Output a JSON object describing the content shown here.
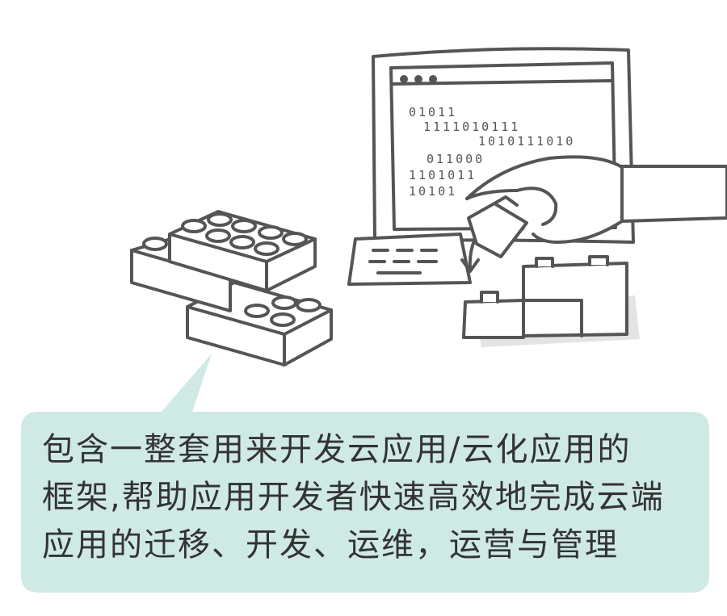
{
  "caption": {
    "lines": [
      "包含一整套用来开发云应用/云化应用的",
      "框架,帮助应用开发者快速高效地完成云端",
      "应用的迁移、开发、运维，运营与管理"
    ]
  },
  "screen": {
    "binary_lines": [
      "01011",
      "1111010111",
      "1010111010",
      "011000",
      "1101011",
      "10101"
    ]
  },
  "colors": {
    "line": "#555555",
    "bubble": "#cfe9e5",
    "shadow": "#e4e4e4",
    "text": "#333333"
  },
  "icons": [
    "lego-brick-stack-icon",
    "computer-monitor-icon",
    "keyboard-icon",
    "hand-icon",
    "lego-blocks-icon",
    "arrow-down-icon"
  ]
}
